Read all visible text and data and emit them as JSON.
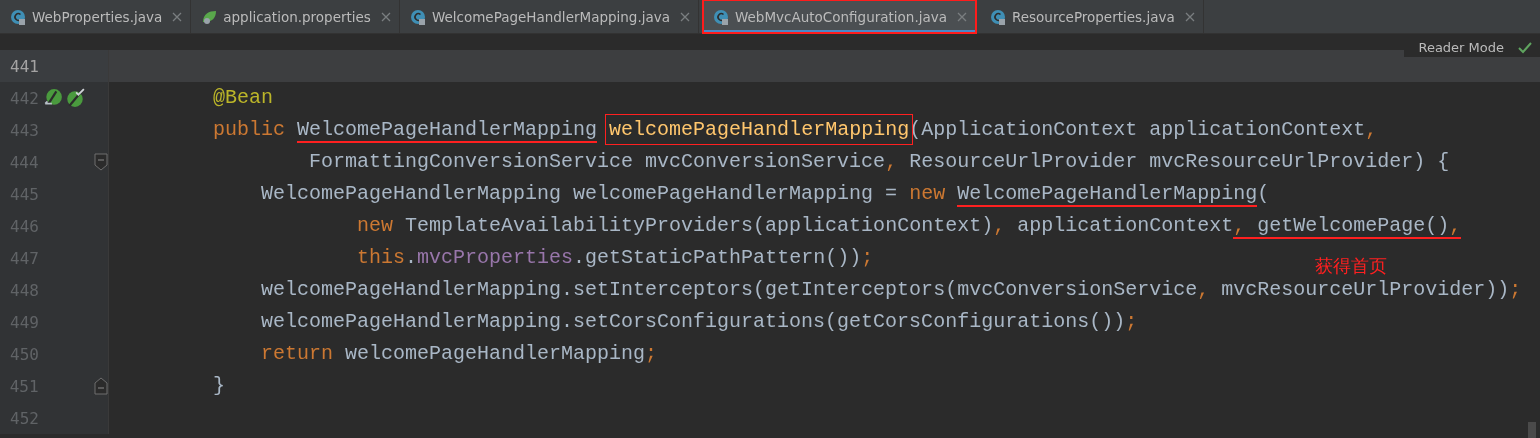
{
  "tabs": [
    {
      "label": "WebProperties.java",
      "kind": "class",
      "selected": false,
      "highlighted": false
    },
    {
      "label": "application.properties",
      "kind": "properties",
      "selected": false,
      "highlighted": false
    },
    {
      "label": "WelcomePageHandlerMapping.java",
      "kind": "class",
      "selected": false,
      "highlighted": false
    },
    {
      "label": "WebMvcAutoConfiguration.java",
      "kind": "class",
      "selected": true,
      "highlighted": true
    },
    {
      "label": "ResourceProperties.java",
      "kind": "class",
      "selected": false,
      "highlighted": false
    }
  ],
  "reader_mode": {
    "label": "Reader Mode"
  },
  "lines": [
    {
      "number": "441",
      "current": true,
      "gutter_icons": false
    },
    {
      "number": "442",
      "current": false,
      "gutter_icons": true,
      "tokens": [
        {
          "kind": "annotation",
          "text": "    @Bean"
        }
      ]
    },
    {
      "number": "443",
      "current": false,
      "gutter_icons": false,
      "tokens": [
        {
          "kind": "keyword",
          "text": "    public "
        },
        {
          "kind": "plain",
          "text": "WelcomePageHandlerMapping",
          "underlined": true
        },
        {
          "kind": "method",
          "text": "welcomePageHandlerMapping",
          "boxed": true
        },
        {
          "kind": "plain",
          "text": "(ApplicationContext applicationContext"
        },
        {
          "kind": "keyword",
          "text": ","
        }
      ]
    },
    {
      "number": "444",
      "current": false,
      "gutter_icons": false,
      "fold_start": true,
      "tokens": [
        {
          "kind": "plain",
          "text": "            FormattingConversionService mvcConversionService"
        },
        {
          "kind": "keyword",
          "text": ", "
        },
        {
          "kind": "plain",
          "text": "ResourceUrlProvider mvcResourceUrlProvider) {"
        }
      ]
    },
    {
      "number": "445",
      "current": false,
      "gutter_icons": false,
      "tokens": [
        {
          "kind": "plain",
          "text": "        WelcomePageHandlerMapping welcomePageHandlerMapping = "
        },
        {
          "kind": "keyword",
          "text": "new "
        },
        {
          "kind": "plain",
          "text": "WelcomePageHandlerMapping",
          "underlined": true
        },
        {
          "kind": "plain",
          "text": "("
        }
      ]
    },
    {
      "number": "446",
      "current": false,
      "gutter_icons": false,
      "tokens": [
        {
          "kind": "keyword",
          "text": "                new "
        },
        {
          "kind": "plain",
          "text": "TemplateAvailabilityProviders(applicationContext)"
        },
        {
          "kind": "keyword",
          "text": ", "
        },
        {
          "kind": "plain",
          "text": "applicationContext"
        },
        {
          "kind": "keyword",
          "text": ", ",
          "underlined": true
        },
        {
          "kind": "plain",
          "text": "getWelcomePage()",
          "underlined": true
        },
        {
          "kind": "keyword",
          "text": ",",
          "underlined": true
        }
      ]
    },
    {
      "number": "447",
      "current": false,
      "gutter_icons": false,
      "tokens": [
        {
          "kind": "keyword",
          "text": "                this"
        },
        {
          "kind": "plain",
          "text": "."
        },
        {
          "kind": "field",
          "text": "mvcProperties"
        },
        {
          "kind": "plain",
          "text": ".getStaticPathPattern())"
        },
        {
          "kind": "keyword",
          "text": ";"
        }
      ]
    },
    {
      "number": "448",
      "current": false,
      "gutter_icons": false,
      "tokens": [
        {
          "kind": "plain",
          "text": "        welcomePageHandlerMapping.setInterceptors(getInterceptors(mvcConversionService"
        },
        {
          "kind": "keyword",
          "text": ", "
        },
        {
          "kind": "plain",
          "text": "mvcResourceUrlProvider))"
        },
        {
          "kind": "keyword",
          "text": ";"
        }
      ]
    },
    {
      "number": "449",
      "current": false,
      "gutter_icons": false,
      "tokens": [
        {
          "kind": "plain",
          "text": "        welcomePageHandlerMapping.setCorsConfigurations(getCorsConfigurations())"
        },
        {
          "kind": "keyword",
          "text": ";"
        }
      ]
    },
    {
      "number": "450",
      "current": false,
      "gutter_icons": false,
      "tokens": [
        {
          "kind": "keyword",
          "text": "        return "
        },
        {
          "kind": "plain",
          "text": "welcomePageHandlerMapping"
        },
        {
          "kind": "keyword",
          "text": ";"
        }
      ]
    },
    {
      "number": "451",
      "current": false,
      "gutter_icons": false,
      "fold_end": true,
      "tokens": [
        {
          "kind": "plain",
          "text": "    }"
        }
      ]
    },
    {
      "number": "452",
      "current": false,
      "gutter_icons": false
    }
  ],
  "note": {
    "text": "获得首页"
  }
}
